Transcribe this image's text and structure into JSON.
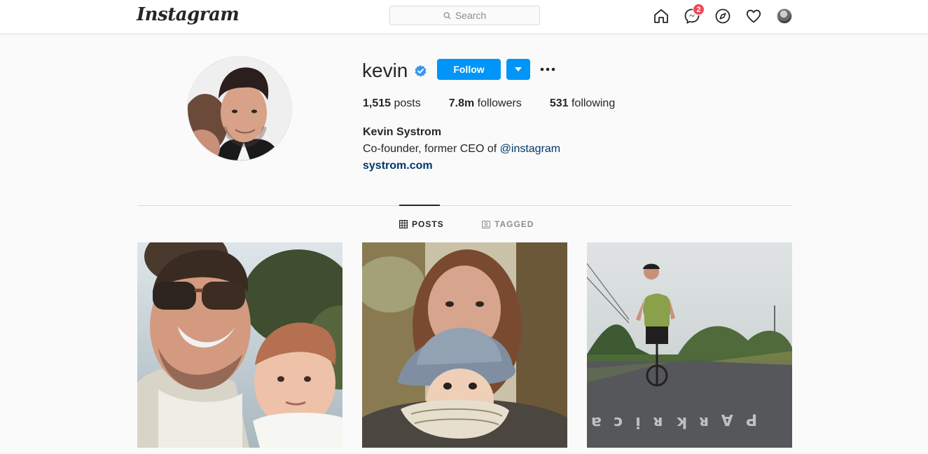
{
  "nav": {
    "logo": "Instagram",
    "search_placeholder": "Search",
    "icons": [
      "home-icon",
      "messenger-icon",
      "explore-icon",
      "heart-icon",
      "avatar"
    ],
    "messages_badge": "2"
  },
  "profile": {
    "username": "kevin",
    "verified": true,
    "follow_label": "Follow",
    "stats": {
      "posts_count": "1,515",
      "posts_label": "posts",
      "followers_count": "7.8m",
      "followers_label": "followers",
      "following_count": "531",
      "following_label": "following"
    },
    "full_name": "Kevin Systrom",
    "bio_text": "Co-founder, former CEO of ",
    "bio_mention": "@instagram",
    "website": "systrom.com"
  },
  "tabs": {
    "posts": "POSTS",
    "tagged": "TAGGED"
  },
  "colors": {
    "accent": "#0095f6",
    "badge": "#ed4956",
    "link": "#00376b",
    "verified": "#3897f0"
  }
}
